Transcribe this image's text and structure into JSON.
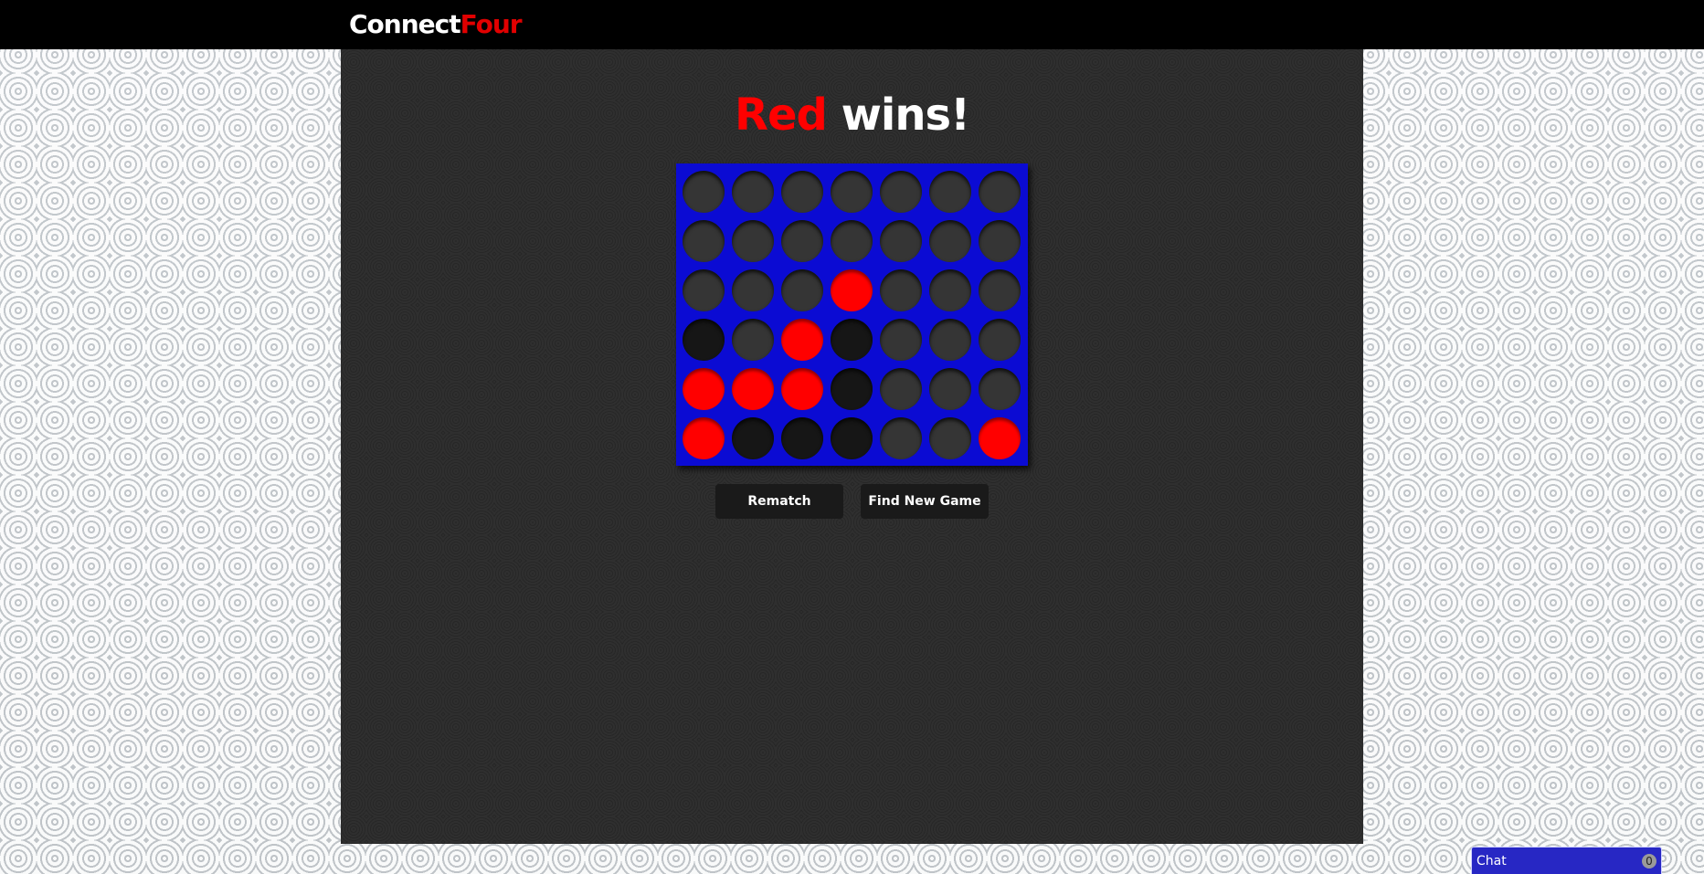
{
  "header": {
    "brand_part1": "Connect",
    "brand_part2": "Four"
  },
  "status": {
    "winner": "Red",
    "suffix": " wins!"
  },
  "board": {
    "rows": 6,
    "cols": 7,
    "cells": [
      [
        "empty",
        "empty",
        "empty",
        "empty",
        "empty",
        "empty",
        "empty"
      ],
      [
        "empty",
        "empty",
        "empty",
        "empty",
        "empty",
        "empty",
        "empty"
      ],
      [
        "empty",
        "empty",
        "empty",
        "red",
        "empty",
        "empty",
        "empty"
      ],
      [
        "black",
        "empty",
        "red",
        "black",
        "empty",
        "empty",
        "empty"
      ],
      [
        "red",
        "red",
        "red",
        "black",
        "empty",
        "empty",
        "empty"
      ],
      [
        "red",
        "black",
        "black",
        "black",
        "empty",
        "empty",
        "red"
      ]
    ]
  },
  "buttons": {
    "rematch_label": "Rematch",
    "find_new_game_label": "Find New Game"
  },
  "chat": {
    "label": "Chat",
    "unread_count": "0"
  },
  "colors": {
    "board": "#0b0bd3",
    "red_disc": "#ff0000",
    "black_disc": "#161616",
    "empty_slot": "#353535",
    "brand_accent": "#e10000"
  }
}
